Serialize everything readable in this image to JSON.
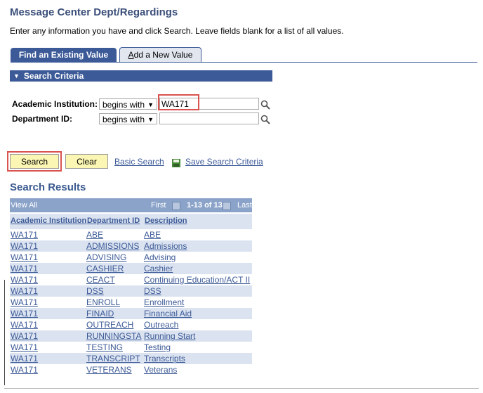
{
  "header": {
    "title": "Message Center Dept/Regardings",
    "instructions": "Enter any information you have and click Search. Leave fields blank for a list of all values."
  },
  "tabs": [
    {
      "label": "Find an Existing Value",
      "active": true
    },
    {
      "label_prefix": "A",
      "label_rest": "dd a New Value",
      "active": false
    }
  ],
  "criteria": {
    "section_label": "Search Criteria",
    "fields": [
      {
        "label": "Academic Institution:",
        "operator": "begins with",
        "value": "WA171"
      },
      {
        "label": "Department ID:",
        "operator": "begins with",
        "value": ""
      }
    ]
  },
  "actions": {
    "search": "Search",
    "clear": "Clear",
    "basic_search": "Basic Search",
    "save_criteria": "Save Search Criteria"
  },
  "results": {
    "title": "Search Results",
    "view_all": "View All",
    "first": "First",
    "range": "1-13 of 13",
    "last": "Last",
    "columns": [
      "Academic Institution",
      "Department ID",
      "Description"
    ],
    "rows": [
      [
        "WA171",
        "ABE",
        "ABE"
      ],
      [
        "WA171",
        "ADMISSIONS",
        "Admissions"
      ],
      [
        "WA171",
        "ADVISING",
        "Advising"
      ],
      [
        "WA171",
        "CASHIER",
        "Cashier"
      ],
      [
        "WA171",
        "CEACT",
        "Continuing Education/ACT II"
      ],
      [
        "WA171",
        "DSS",
        "DSS"
      ],
      [
        "WA171",
        "ENROLL",
        "Enrollment"
      ],
      [
        "WA171",
        "FINAID",
        "Financial Aid"
      ],
      [
        "WA171",
        "OUTREACH",
        "Outreach"
      ],
      [
        "WA171",
        "RUNNINGSTA",
        "Running Start"
      ],
      [
        "WA171",
        "TESTING",
        "Testing"
      ],
      [
        "WA171",
        "TRANSCRIPT",
        "Transcripts"
      ],
      [
        "WA171",
        "VETERANS",
        "Veterans"
      ]
    ]
  },
  "colors": {
    "accent": "#3c5a97",
    "highlight": "#d9534f",
    "button": "#fbf6b3"
  }
}
